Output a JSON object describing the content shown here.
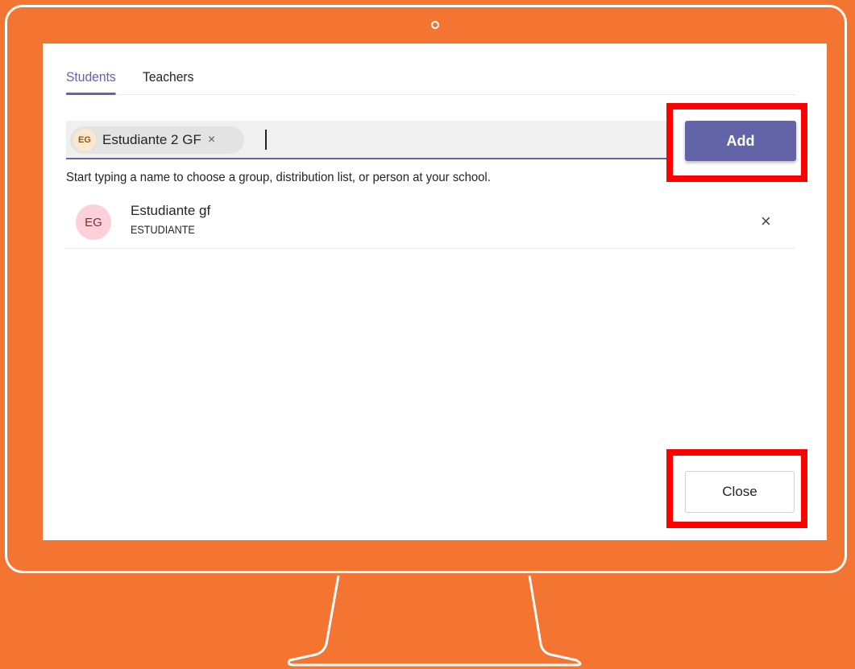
{
  "tabs": [
    {
      "label": "Students",
      "active": true
    },
    {
      "label": "Teachers",
      "active": false
    }
  ],
  "picker": {
    "chip": {
      "initials": "EG",
      "label": "Estudiante 2 GF",
      "close_icon": "×"
    },
    "hint": "Start typing a name to choose a group, distribution list, or person at your school."
  },
  "add_button": {
    "label": "Add"
  },
  "members": [
    {
      "initials": "EG",
      "name": "Estudiante gf",
      "role": "ESTUDIANTE",
      "remove_icon": "×"
    }
  ],
  "close_button": {
    "label": "Close"
  },
  "colors": {
    "background": "#F47432",
    "accent": "#6264a7",
    "highlight": "#ff0000"
  }
}
